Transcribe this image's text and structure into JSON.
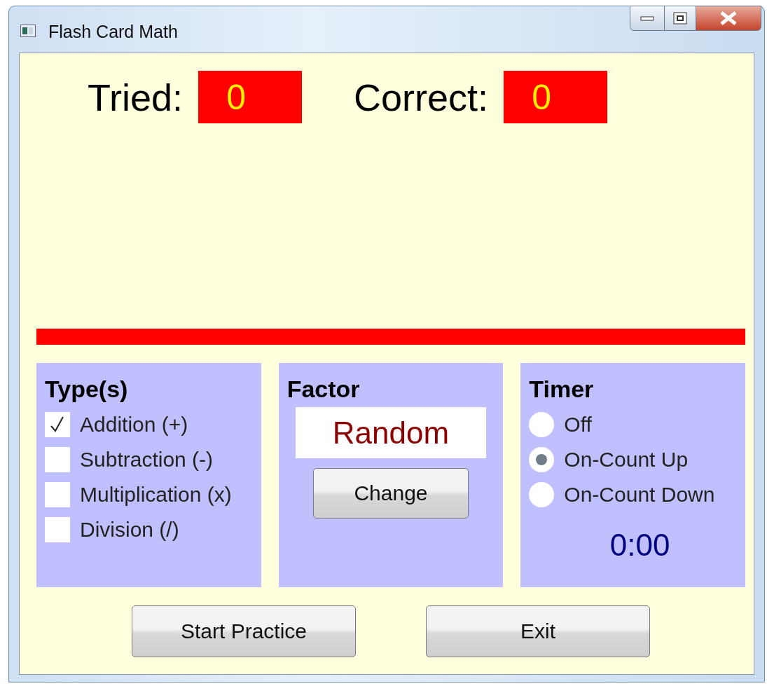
{
  "window": {
    "title": "Flash Card Math"
  },
  "scores": [
    {
      "label": "Tried:",
      "value": "0"
    },
    {
      "label": "Correct:",
      "value": "0"
    }
  ],
  "types": {
    "title": "Type(s)",
    "items": [
      {
        "label": "Addition (+)",
        "checked": true
      },
      {
        "label": "Subtraction (-)",
        "checked": false
      },
      {
        "label": "Multiplication (x)",
        "checked": false
      },
      {
        "label": "Division (/)",
        "checked": false
      }
    ]
  },
  "factor": {
    "title": "Factor",
    "value": "Random",
    "button": "Change"
  },
  "timer": {
    "title": "Timer",
    "options": [
      {
        "label": "Off",
        "selected": false
      },
      {
        "label": "On-Count Up",
        "selected": true
      },
      {
        "label": "On-Count Down",
        "selected": false
      }
    ],
    "time": "0:00"
  },
  "buttons": [
    "Start Practice",
    "Exit"
  ]
}
